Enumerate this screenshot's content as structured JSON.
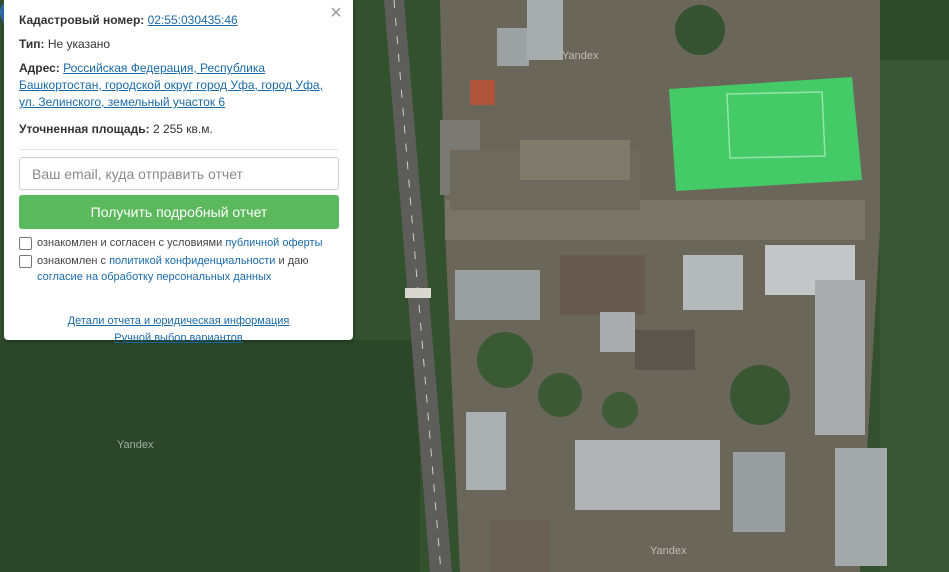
{
  "info": {
    "cadastral_label": "Кадастровый номер:",
    "cadastral_number": "02:55:030435:46",
    "type_label": "Тип:",
    "type_value": "Не указано",
    "address_label": "Адрес:",
    "address_line1": "Российская Федерация, Республика",
    "address_line2": "Башкортостан, городской округ город Уфа, город Уфа,",
    "address_line3": "ул. Зелинского, земельный участок 6",
    "area_label": "Уточненная площадь:",
    "area_value": "2 255 кв.м."
  },
  "form": {
    "email_placeholder": "Ваш email, куда отправить отчет",
    "submit_label": "Получить подробный отчет",
    "consent1_text": "ознакомлен и согласен с условиями ",
    "consent1_link": "публичной оферты",
    "consent2_text": "ознакомлен с ",
    "consent2_link1": "политикой конфиденциальности",
    "consent2_text2": " и даю ",
    "consent2_link2": "согласие на обработку персональных данных"
  },
  "links": {
    "details": "Детали отчета и юридическая информация",
    "manual": "Ручной выбор вариантов"
  },
  "close_glyph": "×",
  "map": {
    "watermark": "Yandex",
    "parcel_color": "#3ddc6a",
    "pin_color": "#2f6fb7"
  }
}
